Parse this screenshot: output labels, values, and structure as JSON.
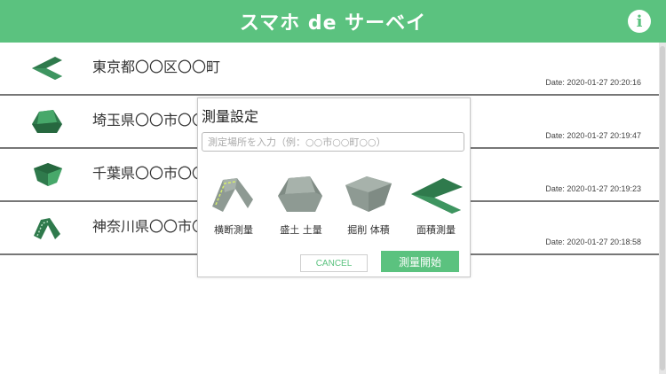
{
  "header": {
    "title": "スマホ de サーベイ",
    "info_icon": "info-icon",
    "info_label": "i"
  },
  "colors": {
    "accent": "#5bc27f",
    "icon_dark": "#2f7a4c",
    "icon_gray": "#8e9a93"
  },
  "surveys": [
    {
      "icon": "area-survey-icon",
      "title": "東京都〇〇区〇〇町",
      "date": "Date: 2020-01-27 20:20:16"
    },
    {
      "icon": "embankment-icon",
      "title": "埼玉県〇〇市〇〇町",
      "date": "Date: 2020-01-27 20:19:47"
    },
    {
      "icon": "excavation-icon",
      "title": "千葉県〇〇市〇〇町",
      "date": "Date: 2020-01-27 20:19:23"
    },
    {
      "icon": "cross-section-icon",
      "title": "神奈川県〇〇市〇〇町",
      "date": "Date: 2020-01-27 20:18:58"
    }
  ],
  "dialog": {
    "title": "測量設定",
    "input_placeholder": "測定場所を入力（例：○○市○○町○○）",
    "input_value": "",
    "options": [
      {
        "icon": "cross-section-icon",
        "label": "横断測量"
      },
      {
        "icon": "embankment-icon",
        "label": "盛土 土量"
      },
      {
        "icon": "excavation-icon",
        "label": "掘削 体積"
      },
      {
        "icon": "area-survey-icon",
        "label": "面積測量"
      }
    ],
    "cancel_label": "CANCEL",
    "start_label": "測量開始"
  }
}
